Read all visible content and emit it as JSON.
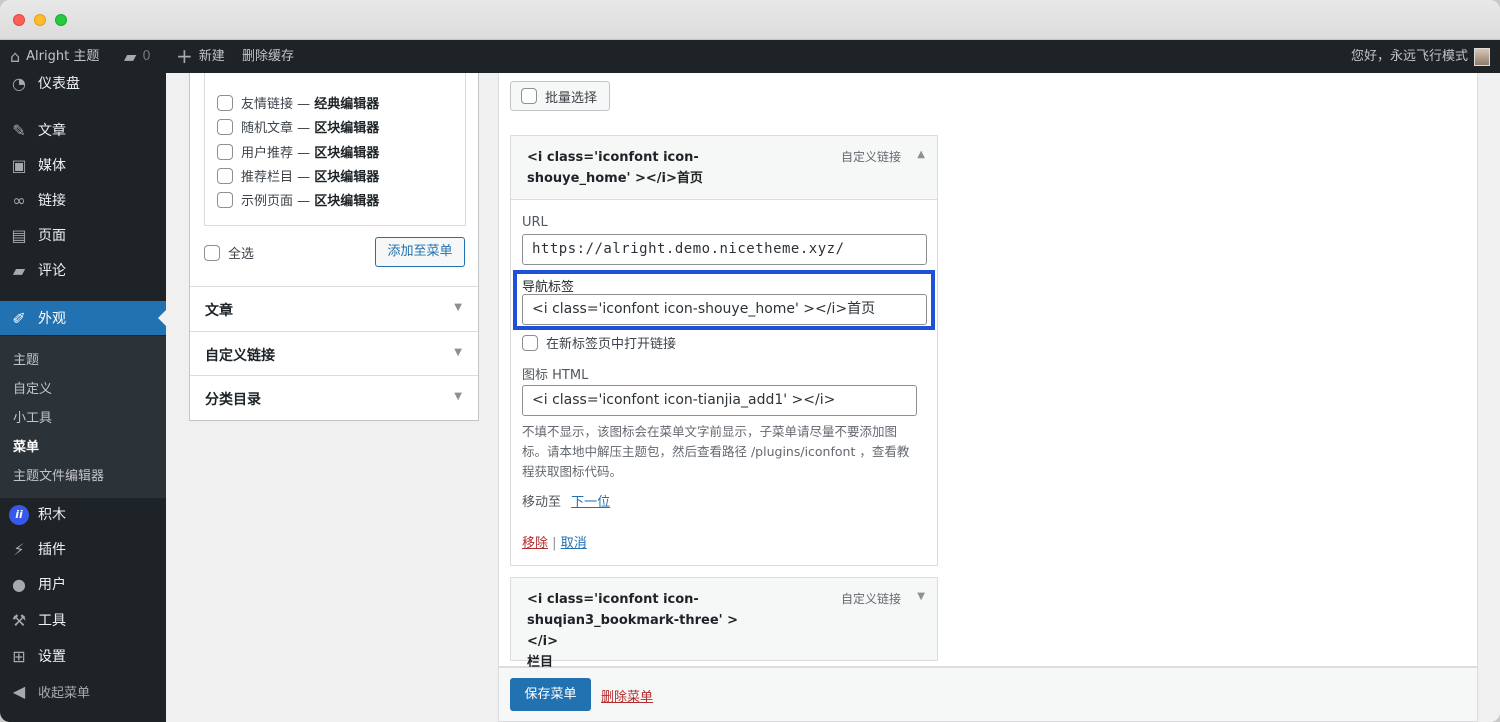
{
  "admin_bar": {
    "site_name": "Alright 主题",
    "comments_count": "0",
    "new_label": "新建",
    "clear_cache_label": "删除缓存",
    "greeting": "您好，永远飞行模式"
  },
  "sidebar": {
    "items": [
      {
        "label": "仪表盘",
        "icon": "dashboard-icon"
      },
      {
        "label": "文章",
        "icon": "pin-icon"
      },
      {
        "label": "媒体",
        "icon": "media-icon"
      },
      {
        "label": "链接",
        "icon": "link-icon"
      },
      {
        "label": "页面",
        "icon": "page-icon"
      },
      {
        "label": "评论",
        "icon": "comment-icon"
      },
      {
        "label": "外观",
        "icon": "brush-icon"
      }
    ],
    "appearance_submenu": [
      "主题",
      "自定义",
      "小工具",
      "菜单",
      "主题文件编辑器"
    ],
    "bottom_items": [
      {
        "label": "积木",
        "icon": "jimu-icon",
        "badge": "ii"
      },
      {
        "label": "插件",
        "icon": "plugin-icon"
      },
      {
        "label": "用户",
        "icon": "user-icon"
      },
      {
        "label": "工具",
        "icon": "wrench-icon"
      },
      {
        "label": "设置",
        "icon": "settings-icon"
      },
      {
        "label": "收起菜单",
        "icon": "collapse-icon"
      }
    ]
  },
  "left_panel": {
    "pages": [
      {
        "name": "友情链接",
        "editor": "经典编辑器"
      },
      {
        "name": "随机文章",
        "editor": "区块编辑器"
      },
      {
        "name": "用户推荐",
        "editor": "区块编辑器"
      },
      {
        "name": "推荐栏目",
        "editor": "区块编辑器"
      },
      {
        "name": "示例页面",
        "editor": "区块编辑器"
      }
    ],
    "dash": " — ",
    "select_all": "全选",
    "add_to_menu": "添加至菜单",
    "sections": [
      "文章",
      "自定义链接",
      "分类目录"
    ]
  },
  "menu_editor": {
    "bulk_select": "批量选择",
    "items": [
      {
        "title_line1": "<i class='iconfont icon-",
        "title_line2": "shouye_home' ></i>首页",
        "type": "自定义链接",
        "url_label": "URL",
        "url": "https://alright.demo.nicetheme.xyz/",
        "nav_label_label": "导航标签",
        "nav_label": "<i class='iconfont icon-shouye_home' ></i>首页",
        "new_tab_label": "在新标签页中打开链接",
        "icon_html_label": "图标 HTML",
        "icon_html": "<i class='iconfont icon-tianjia_add1' ></i>",
        "help_text": "不填不显示，该图标会在菜单文字前显示，子菜单请尽量不要添加图标。请本地中解压主题包，然后查看路径 /plugins/iconfont ，查看教程获取图标代码。",
        "move_to_label": "移动至",
        "move_next": "下一位",
        "remove": "移除",
        "separator": "|",
        "cancel": "取消"
      },
      {
        "title_line1": "<i class='iconfont icon-",
        "title_line2": "shuqian3_bookmark-three' ></i>",
        "title_line3": "栏目",
        "type": "自定义链接"
      }
    ],
    "save_menu": "保存菜单",
    "delete_menu": "删除菜单"
  },
  "colors": {
    "admin_dark": "#1d2327",
    "accent_blue": "#2271b1",
    "highlight_border": "#1e50d8",
    "danger_red": "#b32d2e"
  }
}
